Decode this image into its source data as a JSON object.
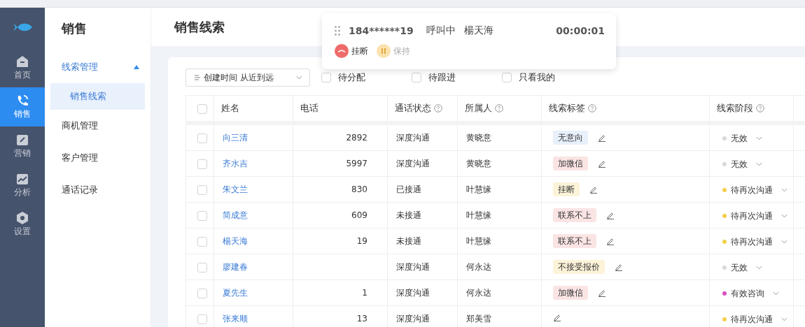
{
  "rail": [
    {
      "label": "首页",
      "selected": false
    },
    {
      "label": "销售",
      "selected": true
    },
    {
      "label": "营销",
      "selected": false
    },
    {
      "label": "分析",
      "selected": false
    },
    {
      "label": "设置",
      "selected": false
    }
  ],
  "subnav": {
    "title": "销售",
    "items": [
      {
        "label": "线索管理",
        "expanded": true,
        "children": [
          {
            "label": "销售线索",
            "selected": true
          }
        ]
      },
      {
        "label": "商机管理"
      },
      {
        "label": "客户管理"
      },
      {
        "label": "通话记录"
      }
    ]
  },
  "page_title": "销售线索",
  "sort_select": {
    "value": "创建时间 从近到远"
  },
  "filters": [
    {
      "label": "待分配",
      "checked": false
    },
    {
      "label": "待跟进",
      "checked": false
    },
    {
      "label": "只看我的",
      "checked": false
    }
  ],
  "call_popup": {
    "number": "184******19",
    "status": "呼叫中",
    "name": "楊天海",
    "timer": "00:00:01",
    "actions": [
      {
        "kind": "hangup",
        "label": "挂断",
        "disabled": false
      },
      {
        "kind": "hold",
        "label": "保持",
        "disabled": true
      }
    ]
  },
  "table": {
    "all_checked": false,
    "columns": [
      {
        "label": "姓名",
        "help": false
      },
      {
        "label": "电话",
        "help": false
      },
      {
        "label": "通话状态",
        "help": true
      },
      {
        "label": "所属人",
        "help": true
      },
      {
        "label": "线索标签",
        "help": true
      },
      {
        "label": "线索阶段",
        "help": true
      }
    ],
    "rows": [
      {
        "checked": false,
        "name": "向三清",
        "phone": "2892",
        "call_status": "深度沟通",
        "owner": "黄晓意",
        "tag": {
          "label": "无意向",
          "color": "#e8f0fb"
        },
        "stage": {
          "label": "无效",
          "color": "#d9d9d9"
        }
      },
      {
        "checked": false,
        "name": "齐水吉",
        "phone": "5997",
        "call_status": "深度沟通",
        "owner": "黄晓意",
        "tag": {
          "label": "加微信",
          "color": "#fbe4e4"
        },
        "stage": {
          "label": "无效",
          "color": "#d9d9d9"
        }
      },
      {
        "checked": false,
        "name": "朱文兰",
        "phone": "830",
        "call_status": "已接通",
        "owner": "叶慧缘",
        "tag": {
          "label": "挂断",
          "color": "#fcf3d9"
        },
        "stage": {
          "label": "待再次沟通",
          "color": "#f2cf4a"
        }
      },
      {
        "checked": false,
        "name": "简成意",
        "phone": "609",
        "call_status": "未接通",
        "owner": "叶慧缘",
        "tag": {
          "label": "联系不上",
          "color": "#fbe4e4"
        },
        "stage": {
          "label": "待再次沟通",
          "color": "#f2cf4a"
        }
      },
      {
        "checked": false,
        "name": "楊天海",
        "phone": "19",
        "call_status": "未接通",
        "owner": "叶慧缘",
        "tag": {
          "label": "联系不上",
          "color": "#fbe4e4"
        },
        "stage": {
          "label": "待再次沟通",
          "color": "#f2cf4a"
        }
      },
      {
        "checked": false,
        "name": "廖建春",
        "call_status": "深度沟通",
        "owner": "何永达",
        "tag": {
          "label": "不接受报价",
          "color": "#fcf3d9"
        },
        "stage": {
          "label": "无效",
          "color": "#d9d9d9"
        }
      },
      {
        "checked": false,
        "name": "夏先生",
        "phone": "1",
        "call_status": "深度沟通",
        "owner": "何永达",
        "tag": {
          "label": "加微信",
          "color": "#fbe4e4"
        },
        "stage": {
          "label": "有效咨询",
          "color": "#d94fc1"
        }
      },
      {
        "checked": false,
        "name": "张来顺",
        "phone": "13",
        "call_status": "深度沟通",
        "owner": "郑美雪",
        "stage": {
          "label": "待再次沟通",
          "color": "#f2cf4a"
        }
      }
    ]
  }
}
